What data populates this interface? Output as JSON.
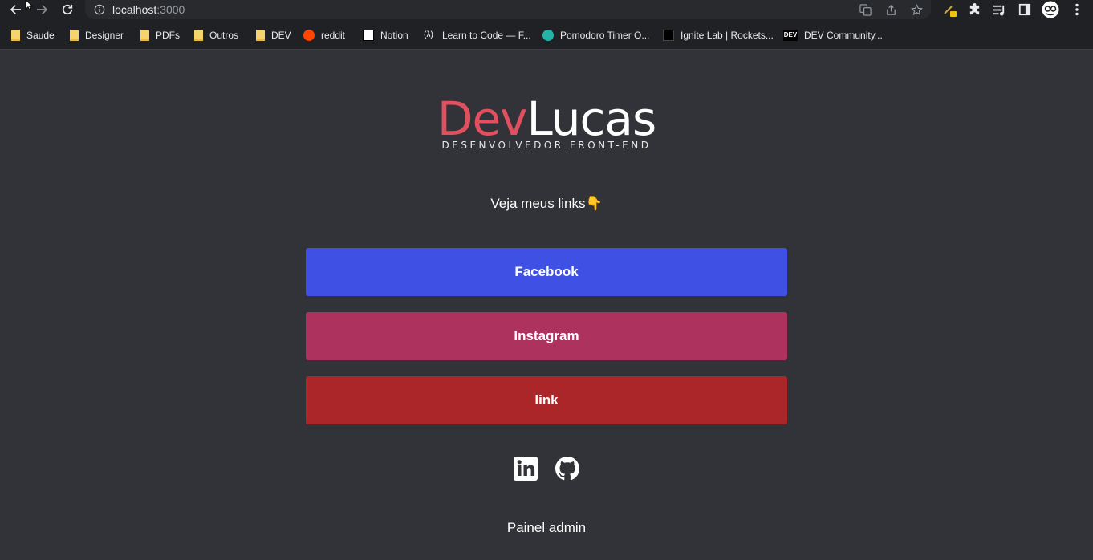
{
  "browser": {
    "url_host": "localhost",
    "url_port": ":3000",
    "bookmarks": [
      {
        "label": "Saude",
        "icon": "folder-icon"
      },
      {
        "label": "Designer",
        "icon": "folder-icon"
      },
      {
        "label": "PDFs",
        "icon": "folder-icon"
      },
      {
        "label": "Outros",
        "icon": "folder-icon"
      },
      {
        "label": "DEV",
        "icon": "folder-icon"
      },
      {
        "label": "reddit",
        "icon": "reddit-icon"
      },
      {
        "label": "Notion",
        "icon": "notion-icon"
      },
      {
        "label": "Learn to Code — F...",
        "icon": "freecodecamp-icon"
      },
      {
        "label": "Pomodoro Timer O...",
        "icon": "pomodoro-icon"
      },
      {
        "label": "Ignite Lab | Rockets...",
        "icon": "rocketseat-icon"
      },
      {
        "label": "DEV Community...",
        "icon": "dev-community-icon"
      }
    ],
    "dev_icon_text": "DEV",
    "fcc_icon_text": "(λ)"
  },
  "page": {
    "logo_dev": "Dev",
    "logo_lucas": "Lucas",
    "logo_subtitle": "DESENVOLVEDOR FRONT-END",
    "tagline": "Veja meus links👇",
    "links": [
      {
        "label": "Facebook",
        "color": "#3f50e4"
      },
      {
        "label": "Instagram",
        "color": "#ad335e"
      },
      {
        "label": "link",
        "color": "#ab2628"
      }
    ],
    "socials": [
      "linkedin-icon",
      "github-icon"
    ],
    "admin_label": "Painel admin"
  },
  "colors": {
    "background": "#323338",
    "logo_accent": "#e2505f"
  }
}
